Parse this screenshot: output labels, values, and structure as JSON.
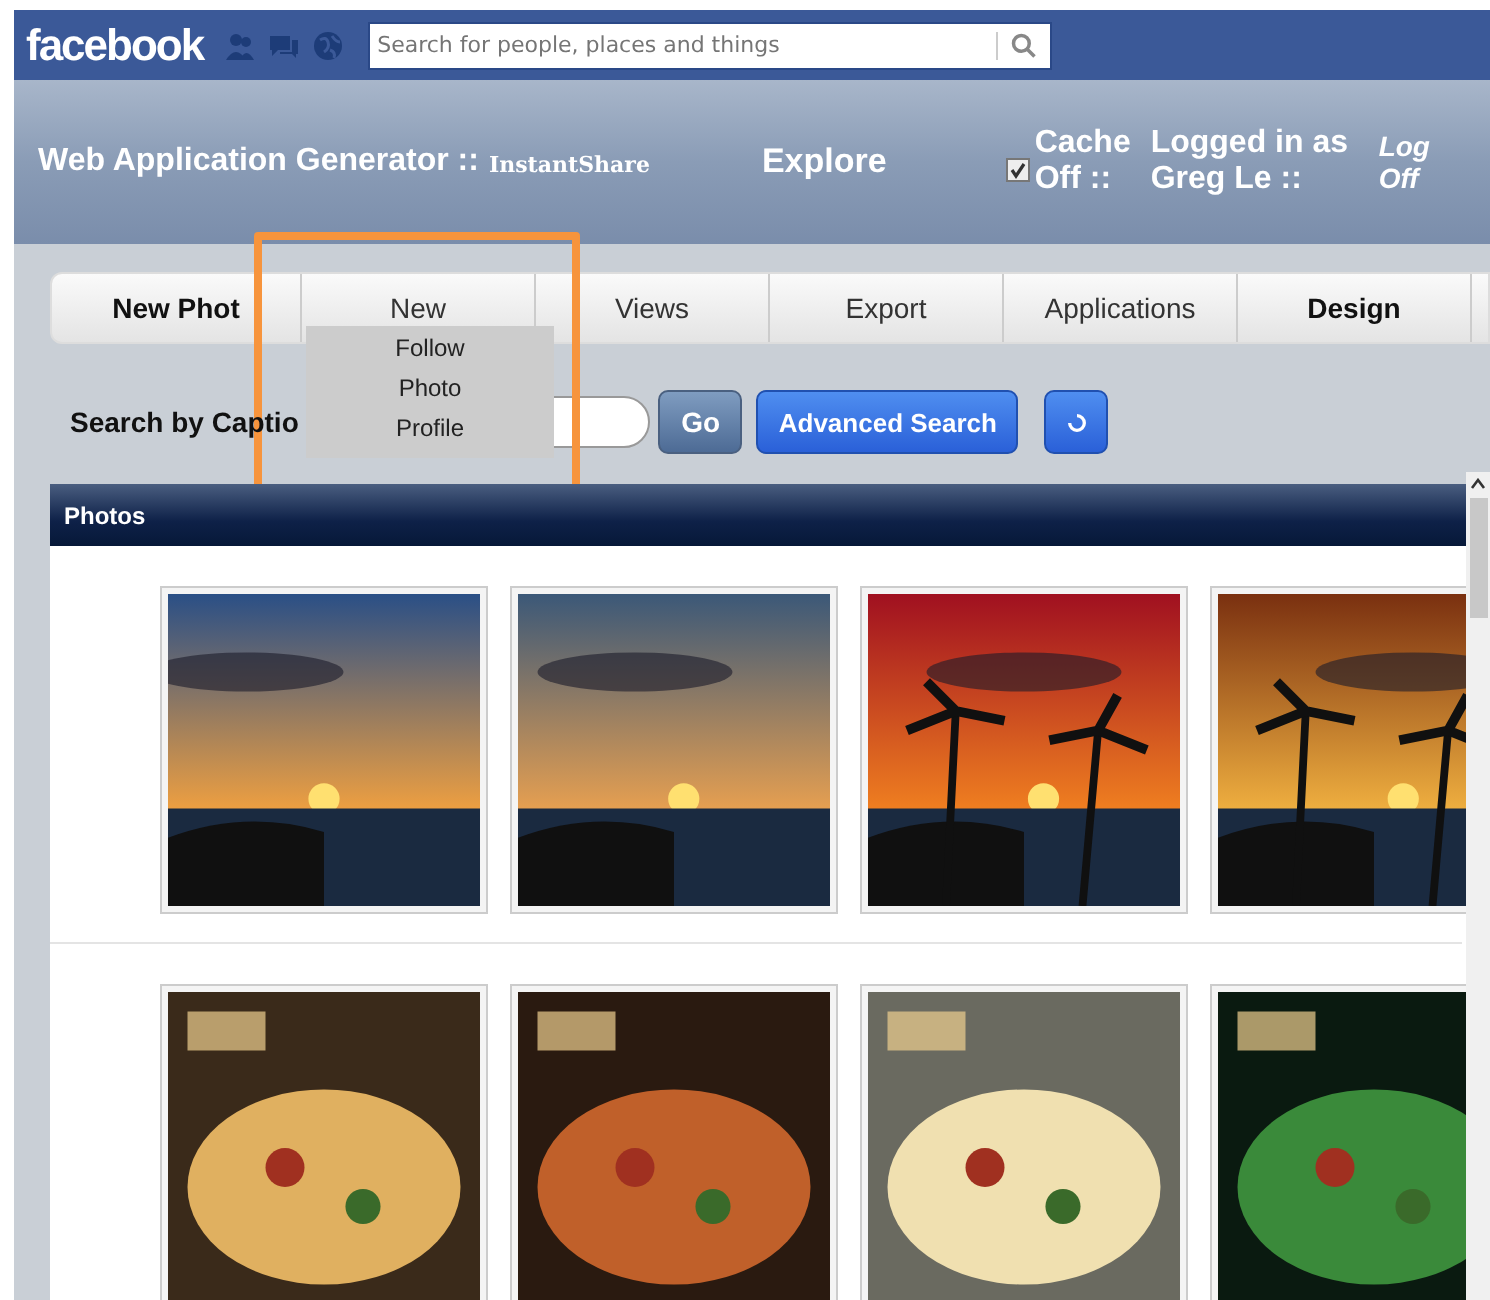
{
  "facebook_bar": {
    "logo": "facebook",
    "search": {
      "placeholder": "Search for people, places and things"
    }
  },
  "header": {
    "title": "Web Application Generator ::",
    "app_name": "InstantShare",
    "explore": "Explore",
    "cache": {
      "label": "Cache Off ::",
      "checked": true
    },
    "logged_in": "Logged in as Greg Le ::",
    "log_off": "Log Off"
  },
  "tabs": [
    {
      "label": "New Phot",
      "bold": true
    },
    {
      "label": "New",
      "bold": false
    },
    {
      "label": "Views",
      "bold": false
    },
    {
      "label": "Export",
      "bold": false
    },
    {
      "label": "Applications",
      "bold": false
    },
    {
      "label": "Design",
      "bold": true
    }
  ],
  "dropdown": {
    "items": [
      "Follow",
      "Photo",
      "Profile"
    ]
  },
  "search": {
    "label": "Search by Captio",
    "go": "Go",
    "advanced": "Advanced Search"
  },
  "photos_panel": {
    "title": "Photos"
  }
}
